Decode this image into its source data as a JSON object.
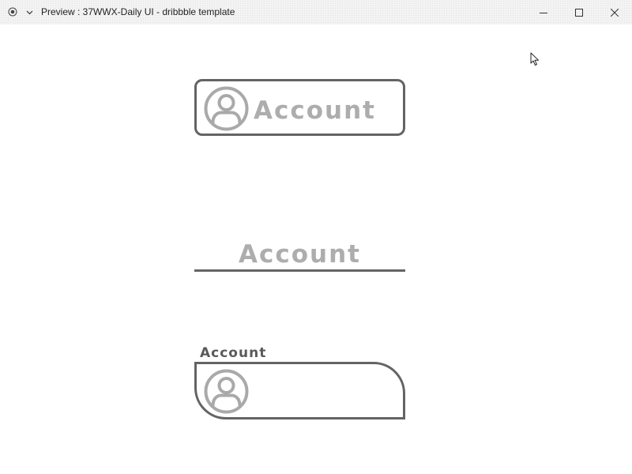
{
  "window": {
    "title": "Preview : 37WWX-Daily UI - dribbble template",
    "icons": {
      "app": "record-icon",
      "menu": "chevron-down-icon",
      "minimize": "minimize-icon",
      "maximize": "maximize-icon",
      "close": "close-icon"
    }
  },
  "fields": {
    "outlined": {
      "label": "Account",
      "icon": "user-circle-icon"
    },
    "underlined": {
      "label": "Account"
    },
    "captioned": {
      "caption": "Account",
      "value": "",
      "icon": "user-circle-icon"
    }
  },
  "colors": {
    "border": "#646464",
    "label": "#adadad",
    "caption": "#5a5a5a",
    "icon": "#a9a9a9",
    "titlebar": "#f3f3f3"
  }
}
